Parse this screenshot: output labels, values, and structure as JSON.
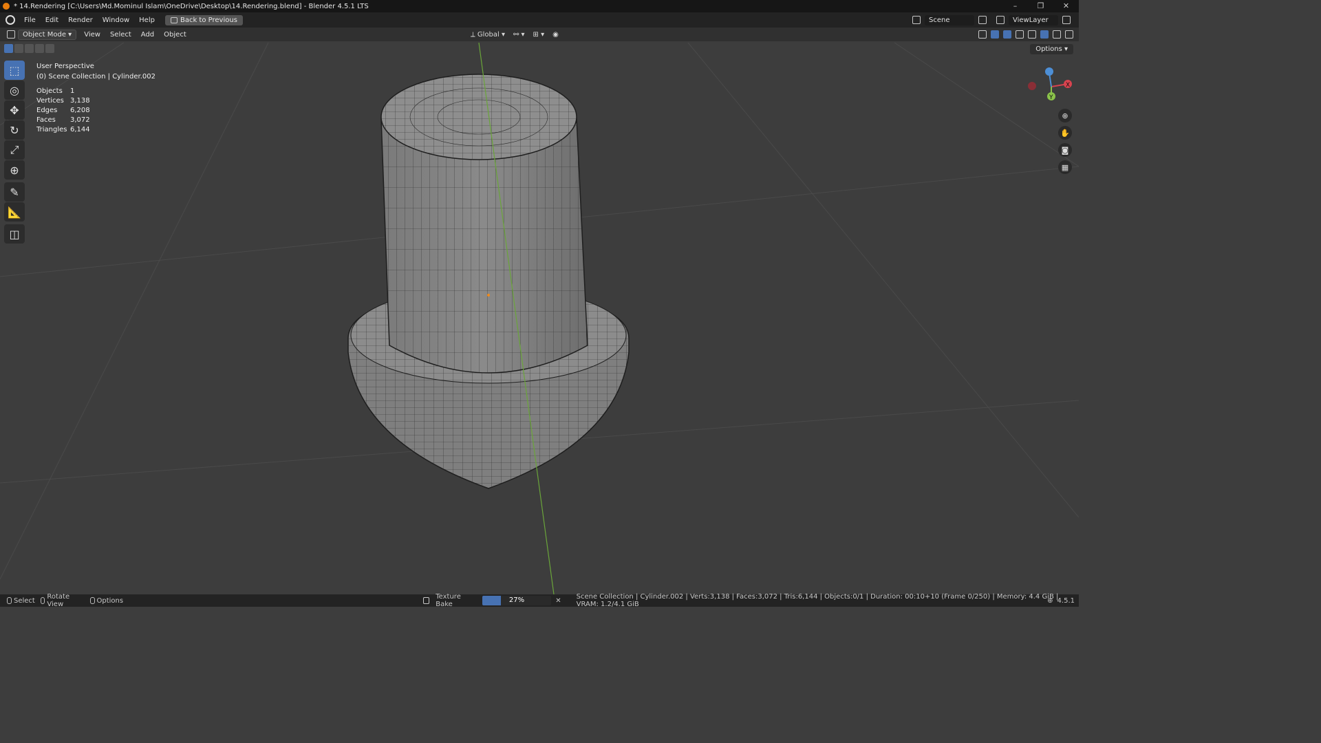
{
  "window": {
    "title": "* 14.Rendering [C:\\Users\\Md.Mominul Islam\\OneDrive\\Desktop\\14.Rendering.blend] - Blender 4.5.1 LTS",
    "controls": [
      "–",
      "❐",
      "✕"
    ]
  },
  "menubar": {
    "items": [
      "File",
      "Edit",
      "Render",
      "Window",
      "Help"
    ],
    "back_button": "Back to Previous",
    "scene": "Scene",
    "view_layer": "ViewLayer"
  },
  "viewport_header": {
    "mode": "Object Mode",
    "menus": [
      "View",
      "Select",
      "Add",
      "Object"
    ],
    "orientation": "Global",
    "options_label": "Options"
  },
  "overlay": {
    "perspective": "User Perspective",
    "collection": "(0) Scene Collection | Cylinder.002",
    "stats": [
      {
        "label": "Objects",
        "value": "1"
      },
      {
        "label": "Vertices",
        "value": "3,138"
      },
      {
        "label": "Edges",
        "value": "6,208"
      },
      {
        "label": "Faces",
        "value": "3,072"
      },
      {
        "label": "Triangles",
        "value": "6,144"
      }
    ]
  },
  "gizmo": {
    "x_label": "X",
    "y_label": "Y"
  },
  "statusbar": {
    "select": "Select",
    "rotate": "Rotate View",
    "options": "Options",
    "job": "Texture Bake",
    "progress_label": "27%",
    "progress_fraction": 0.27,
    "scene_info": "Scene Collection | Cylinder.002 | Verts:3,138 | Faces:3,072 | Tris:6,144 | Objects:0/1 | Duration: 00:10+10 (Frame 0/250) | Memory: 4.4 GiB | VRAM: 1.2/4.1 GiB",
    "version": "4.5.1"
  },
  "colors": {
    "accent": "#4772b3",
    "x_axis": "#d8434f",
    "y_axis": "#8bc34a",
    "z_axis": "#4d8fd6"
  }
}
